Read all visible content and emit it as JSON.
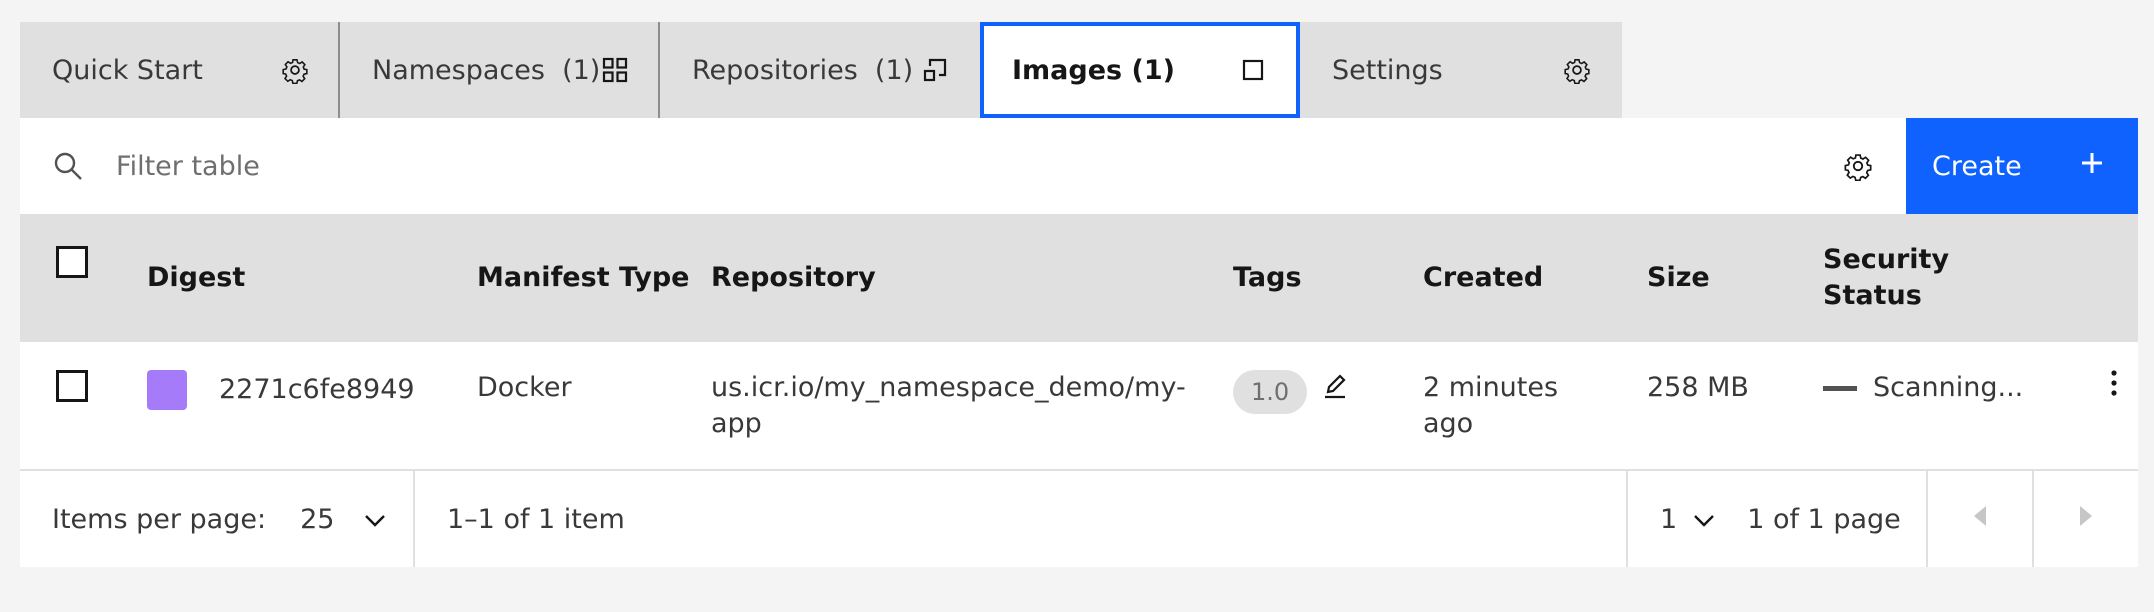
{
  "tabs": [
    {
      "label": "Quick Start",
      "icon": "gear-icon",
      "active": false
    },
    {
      "label": "Namespaces  (1)",
      "icon": "grid-icon",
      "active": false
    },
    {
      "label": "Repositories  (1)",
      "icon": "repository-icon",
      "active": false
    },
    {
      "label": "Images (1)",
      "icon": "square-icon",
      "active": true
    },
    {
      "label": "Settings",
      "icon": "gear-icon",
      "active": false
    }
  ],
  "toolbar": {
    "search_placeholder": "Filter table",
    "create_label": "Create"
  },
  "table": {
    "columns": [
      "Digest",
      "Manifest Type",
      "Repository",
      "Tags",
      "Created",
      "Size",
      "Security Status"
    ],
    "rows": [
      {
        "digest": "2271c6fe8949",
        "manifest_type": "Docker",
        "repository": "us.icr.io/my_namespace_demo/my-app",
        "tag": "1.0",
        "created": "2 minutes ago",
        "size": "258 MB",
        "security_status": "Scanning..."
      }
    ]
  },
  "pagination": {
    "items_per_page_label": "Items per page:",
    "items_per_page_value": "25",
    "range_text": "1–1 of 1 item",
    "page_value": "1",
    "pages_text": "1 of 1 page"
  },
  "colors": {
    "accent": "#0f62fe",
    "digest_swatch": "#a57bfa",
    "tab_bg": "#e0e0e0",
    "page_bg": "#f4f4f4"
  }
}
